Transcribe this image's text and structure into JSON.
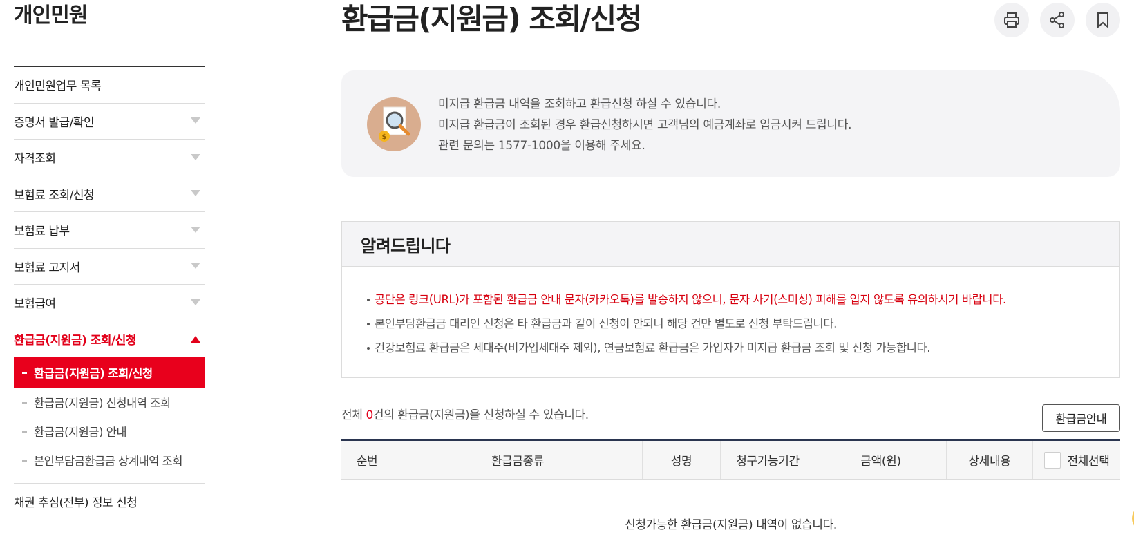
{
  "sidebar": {
    "title": "개인민원",
    "items": [
      {
        "label": "개인민원업무 목록",
        "has_toggle": false
      },
      {
        "label": "증명서 발급/확인",
        "has_toggle": true
      },
      {
        "label": "자격조회",
        "has_toggle": true
      },
      {
        "label": "보험료 조회/신청",
        "has_toggle": true
      },
      {
        "label": "보험료 납부",
        "has_toggle": true
      },
      {
        "label": "보험료 고지서",
        "has_toggle": true
      },
      {
        "label": "보험급여",
        "has_toggle": true
      },
      {
        "label": "환급금(지원금) 조회/신청",
        "has_toggle": true,
        "expanded": true
      }
    ],
    "sub_items": [
      {
        "label": "환급금(지원금) 조회/신청",
        "current": true
      },
      {
        "label": "환급금(지원금) 신청내역 조회"
      },
      {
        "label": "환급금(지원금) 안내"
      },
      {
        "label": "본인부담금환급금 상계내역 조회"
      }
    ],
    "after_items": [
      {
        "label": "채권 추심(전부) 정보 신청",
        "has_toggle": false
      }
    ]
  },
  "header": {
    "title": "환급금(지원금) 조회/신청",
    "tools": [
      {
        "name": "print-icon"
      },
      {
        "name": "share-icon"
      },
      {
        "name": "bookmark-icon"
      }
    ]
  },
  "intro": {
    "icon": "search-money-icon",
    "lines": [
      "미지급 환급금 내역을 조회하고 환급신청 하실 수 있습니다.",
      "미지급 환급금이 조회된 경우 환급신청하시면 고객님의 예금계좌로 입금시켜 드립니다.",
      "관련 문의는 1577-1000을 이용해 주세요."
    ]
  },
  "notice": {
    "title": "알려드립니다",
    "items": [
      {
        "text": "공단은 링크(URL)가 포함된 환급금 안내 문자(카카오톡)를 발송하지 않으니, 문자 사기(스미싱) 피해를 입지 않도록 유의하시기 바랍니다.",
        "warn": true
      },
      {
        "text": "본인부담환급금 대리인 신청은 타 환급금과 같이 신청이 안되니 해당 건만 별도로 신청 부탁드립니다.",
        "warn": false
      },
      {
        "text": "건강보험료 환급금은 세대주(비가입세대주 제외), 연금보험료 환급금은 가입자가 미지급 환급금 조회 및 신청 가능합니다.",
        "warn": false
      }
    ]
  },
  "summary": {
    "prefix": "전체 ",
    "count": "0",
    "suffix": "건의 환급금(지원금)을 신청하실 수 있습니다.",
    "guide_button": "환급금안내"
  },
  "table": {
    "columns": [
      "순번",
      "환급금종류",
      "성명",
      "청구가능기간",
      "금액(원)",
      "상세내용"
    ],
    "select_all_label": "전체선택",
    "empty_message": "신청가능한 환급금(지원금) 내역이 없습니다."
  },
  "colors": {
    "accent": "#e8001c",
    "warning_text": "#d7000f",
    "table_border": "#2a3550"
  }
}
